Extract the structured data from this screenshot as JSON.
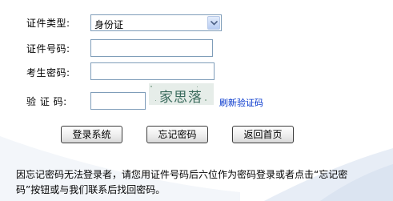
{
  "form": {
    "id_type_label": "证件类型:",
    "id_type_value": "身份证",
    "id_number_label": "证件号码:",
    "id_number_value": "",
    "password_label": "考生密码:",
    "password_value": "",
    "captcha_label": "验 证 码:",
    "captcha_value": "",
    "captcha_image_text": "家思落",
    "refresh_link": "刷新验证码"
  },
  "buttons": {
    "login": "登录系统",
    "forgot": "忘记密码",
    "home": "返回首页"
  },
  "notice": "因忘记密码无法登录者，请您用证件号码后六位作为密码登录或者点击“忘记密码”按钮或与我们联系后找回密码。",
  "colors": {
    "link": "#0033cc",
    "field_border": "#7f9db9",
    "swoosh": "#dde6f2"
  },
  "icons": {
    "dropdown": "chevron-down-icon"
  }
}
